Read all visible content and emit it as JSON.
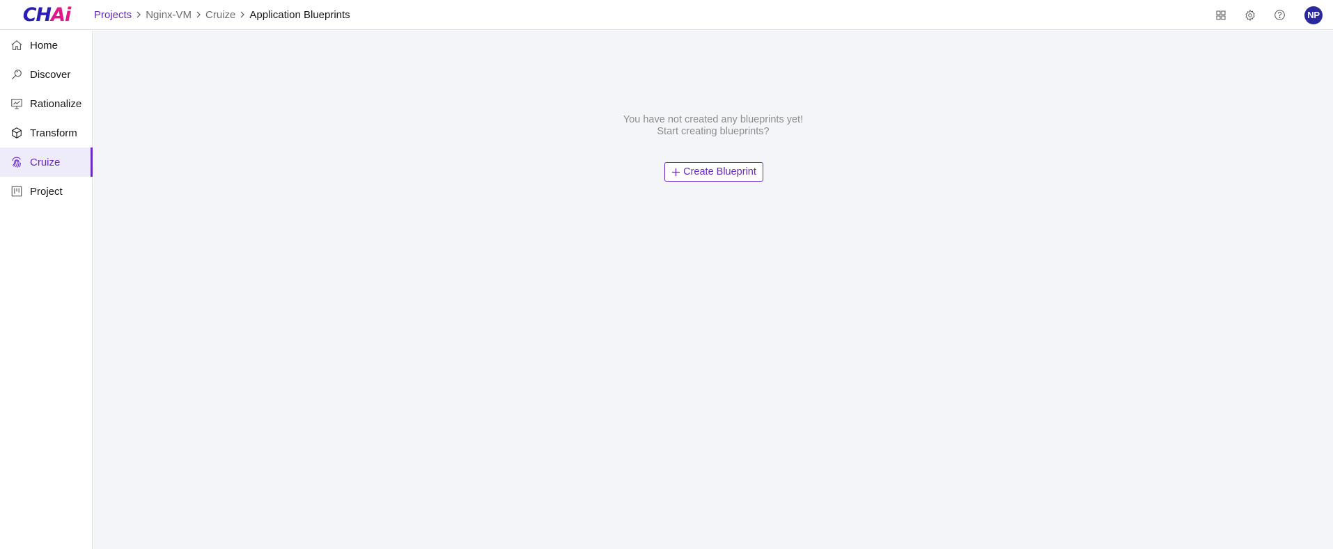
{
  "app": {
    "logo_text_a": "CH",
    "logo_text_b": "Ai"
  },
  "breadcrumb": {
    "items": [
      "Projects",
      "Nginx-VM",
      "Cruize",
      "Application Blueprints"
    ]
  },
  "header": {
    "avatar_initials": "NP",
    "icons": [
      "apps-grid-icon",
      "settings-gear-icon",
      "help-icon"
    ]
  },
  "sidebar": {
    "items": [
      {
        "label": "Home",
        "icon": "home-icon"
      },
      {
        "label": "Discover",
        "icon": "discover-search-icon"
      },
      {
        "label": "Rationalize",
        "icon": "presentation-chart-icon"
      },
      {
        "label": "Transform",
        "icon": "cube-icon"
      },
      {
        "label": "Cruize",
        "icon": "fingerprint-icon",
        "active": true
      },
      {
        "label": "Project",
        "icon": "kanban-board-icon"
      }
    ]
  },
  "main": {
    "empty_line1": "You have not created any blueprints yet!",
    "empty_line2": "Start creating blueprints?",
    "create_button_label": "Create Blueprint"
  },
  "colors": {
    "accent": "#6929c4",
    "avatar_bg": "#2a2a9e",
    "main_bg": "#f4f5f8",
    "active_nav_bg": "#eeebfb"
  }
}
